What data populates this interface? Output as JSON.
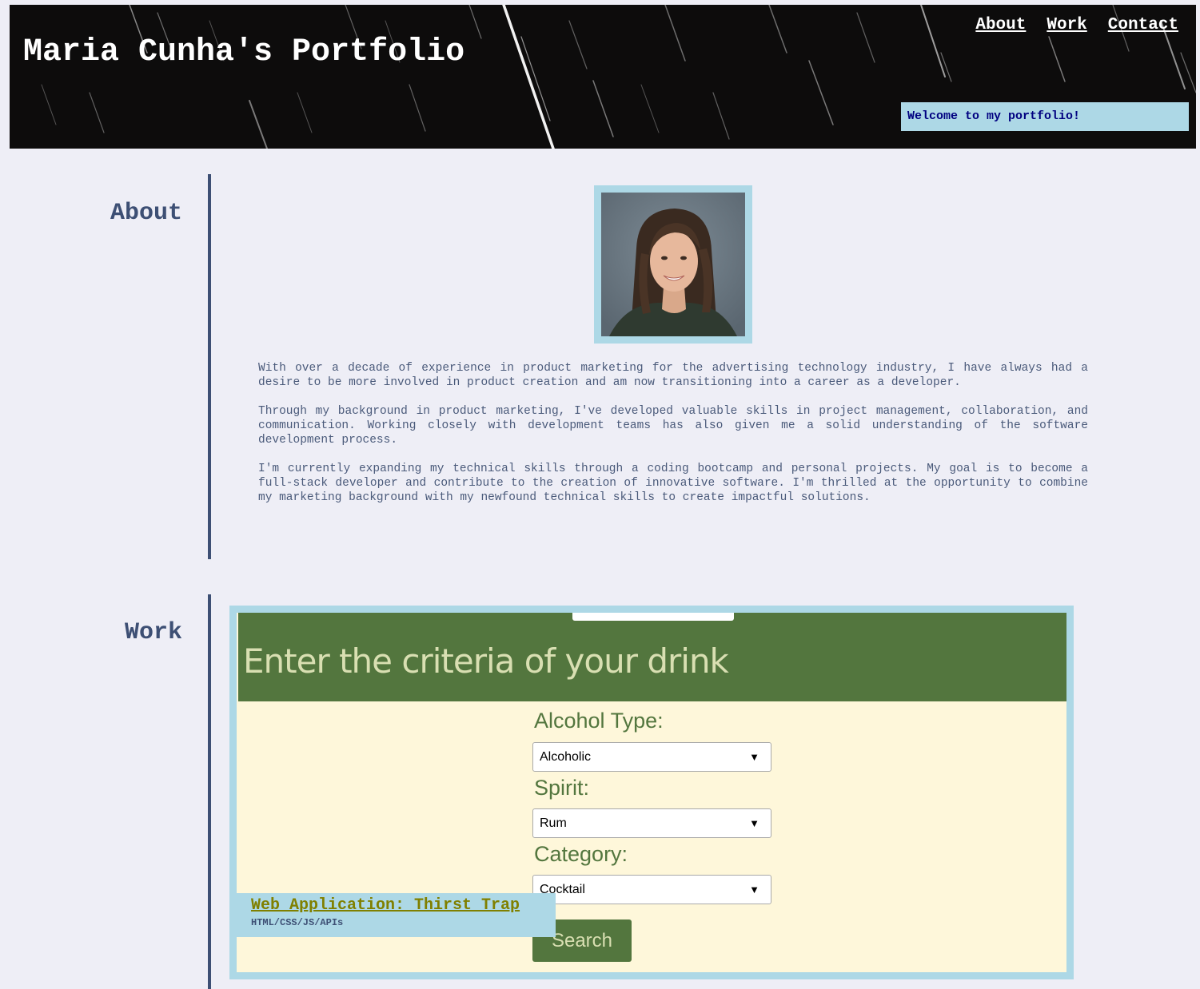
{
  "header": {
    "title": "Maria Cunha's Portfolio",
    "nav": [
      "About",
      "Work",
      "Contact"
    ],
    "welcome": "Welcome to my portfolio!"
  },
  "about": {
    "heading": "About",
    "paragraphs": [
      "With over a decade of experience in product marketing for the advertising technology industry, I have always had a desire to be more involved in product creation and am now transitioning into a career as a developer.",
      "Through my background in product marketing, I've developed valuable skills in project management, collaboration, and communication. Working closely with development teams has also given me a solid understanding of the software development process.",
      "I'm currently expanding my technical skills through a coding bootcamp and personal projects. My goal is to become a full-stack developer and contribute to the creation of innovative software. I'm thrilled at the opportunity to combine my marketing background with my newfound technical skills to create impactful solutions."
    ]
  },
  "work": {
    "heading": "Work",
    "project": {
      "screenshot": {
        "headline": "Enter the criteria of your drink",
        "fields": [
          {
            "label": "Alcohol Type:",
            "value": "Alcoholic"
          },
          {
            "label": "Spirit:",
            "value": "Rum"
          },
          {
            "label": "Category:",
            "value": "Cocktail"
          }
        ],
        "button": "Search",
        "arrow": "▼"
      },
      "title": "Web Application: Thirst Trap",
      "tech": "HTML/CSS/JS/APIs"
    }
  },
  "colors": {
    "page_bg": "#eeeef6",
    "header_bg": "#0d0c0c",
    "accent_light_blue": "#add8e6",
    "heading_navy": "#3d4f74",
    "welcome_text": "#000080",
    "app_green": "#53763e",
    "app_cream": "#fef7da",
    "project_link": "#808000"
  }
}
